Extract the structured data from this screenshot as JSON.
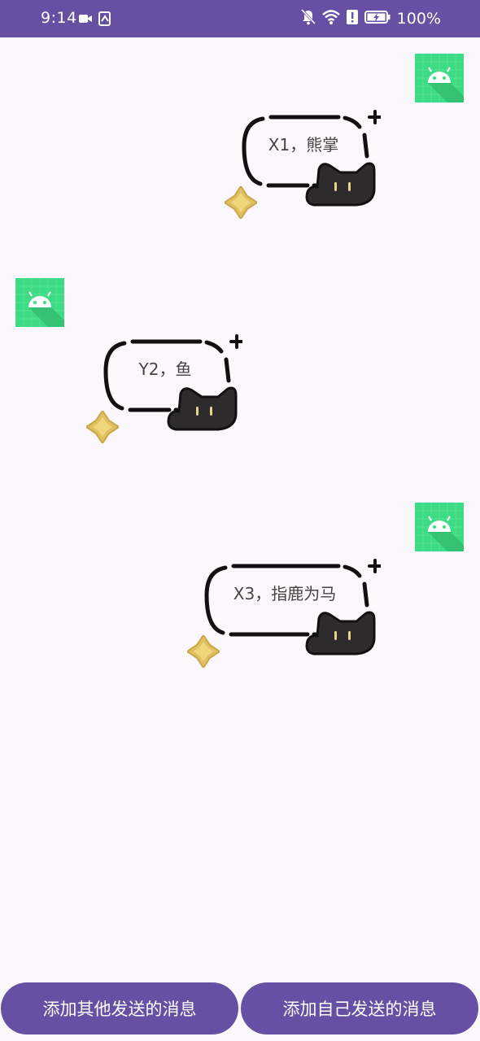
{
  "status_bar": {
    "time": "9:14",
    "battery": "100%",
    "background_color": "#6750a4",
    "icons_left": [
      "video-camera-icon",
      "screenshot-icon"
    ],
    "icons_right": [
      "notifications-off-icon",
      "wifi-icon",
      "alert-icon",
      "battery-charging-icon"
    ]
  },
  "messages": [
    {
      "sender": "self",
      "text": "X1，熊掌",
      "avatar_icon": "android-icon"
    },
    {
      "sender": "other",
      "text": "Y2，鱼",
      "avatar_icon": "android-icon"
    },
    {
      "sender": "self",
      "text": "X3，指鹿为马",
      "avatar_icon": "android-icon"
    }
  ],
  "buttons": {
    "add_other": "添加其他发送的消息",
    "add_self": "添加自己发送的消息"
  },
  "colors": {
    "primary": "#6750a4",
    "background": "#fcf7fb",
    "avatar_green": "#3ddc84",
    "sparkle_gold": "#e0c060",
    "cat_body": "#2e2b2c"
  }
}
